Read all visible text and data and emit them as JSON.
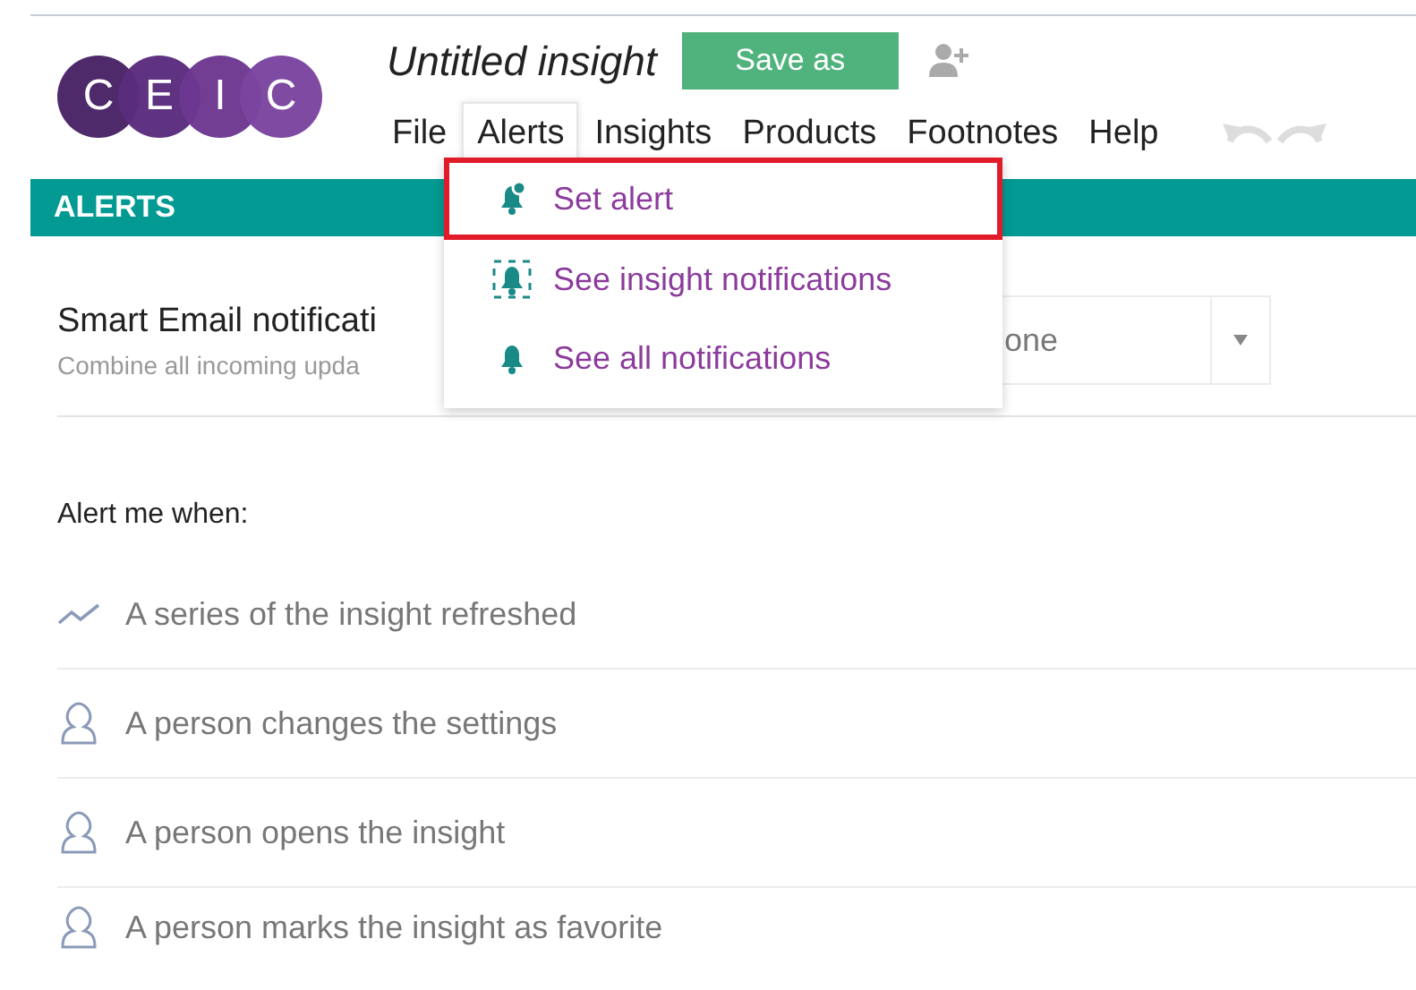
{
  "logo": {
    "letters": [
      "C",
      "E",
      "I",
      "C"
    ]
  },
  "title": "Untitled insight",
  "save_button": "Save as",
  "menu": [
    {
      "label": "File",
      "selected": false
    },
    {
      "label": "Alerts",
      "selected": true
    },
    {
      "label": "Insights",
      "selected": false
    },
    {
      "label": "Products",
      "selected": false
    },
    {
      "label": "Footnotes",
      "selected": false
    },
    {
      "label": "Help",
      "selected": false
    }
  ],
  "section_bar": "ALERTS",
  "dropdown": [
    {
      "label": "Set alert",
      "kind": "set",
      "selected": true
    },
    {
      "label": "See insight notifications",
      "kind": "insight",
      "selected": false
    },
    {
      "label": "See all notifications",
      "kind": "all",
      "selected": false
    }
  ],
  "smart_email": {
    "label": "Smart Email notificati",
    "hint": "Combine all incoming upda",
    "value": "one"
  },
  "alert_heading": "Alert me when:",
  "alert_rows": [
    {
      "kind": "series",
      "label": "A series of the insight refreshed"
    },
    {
      "kind": "person",
      "label": "A person changes the settings"
    },
    {
      "kind": "person",
      "label": "A person opens the insight"
    },
    {
      "kind": "person",
      "label": "A person marks the insight as favorite"
    }
  ]
}
